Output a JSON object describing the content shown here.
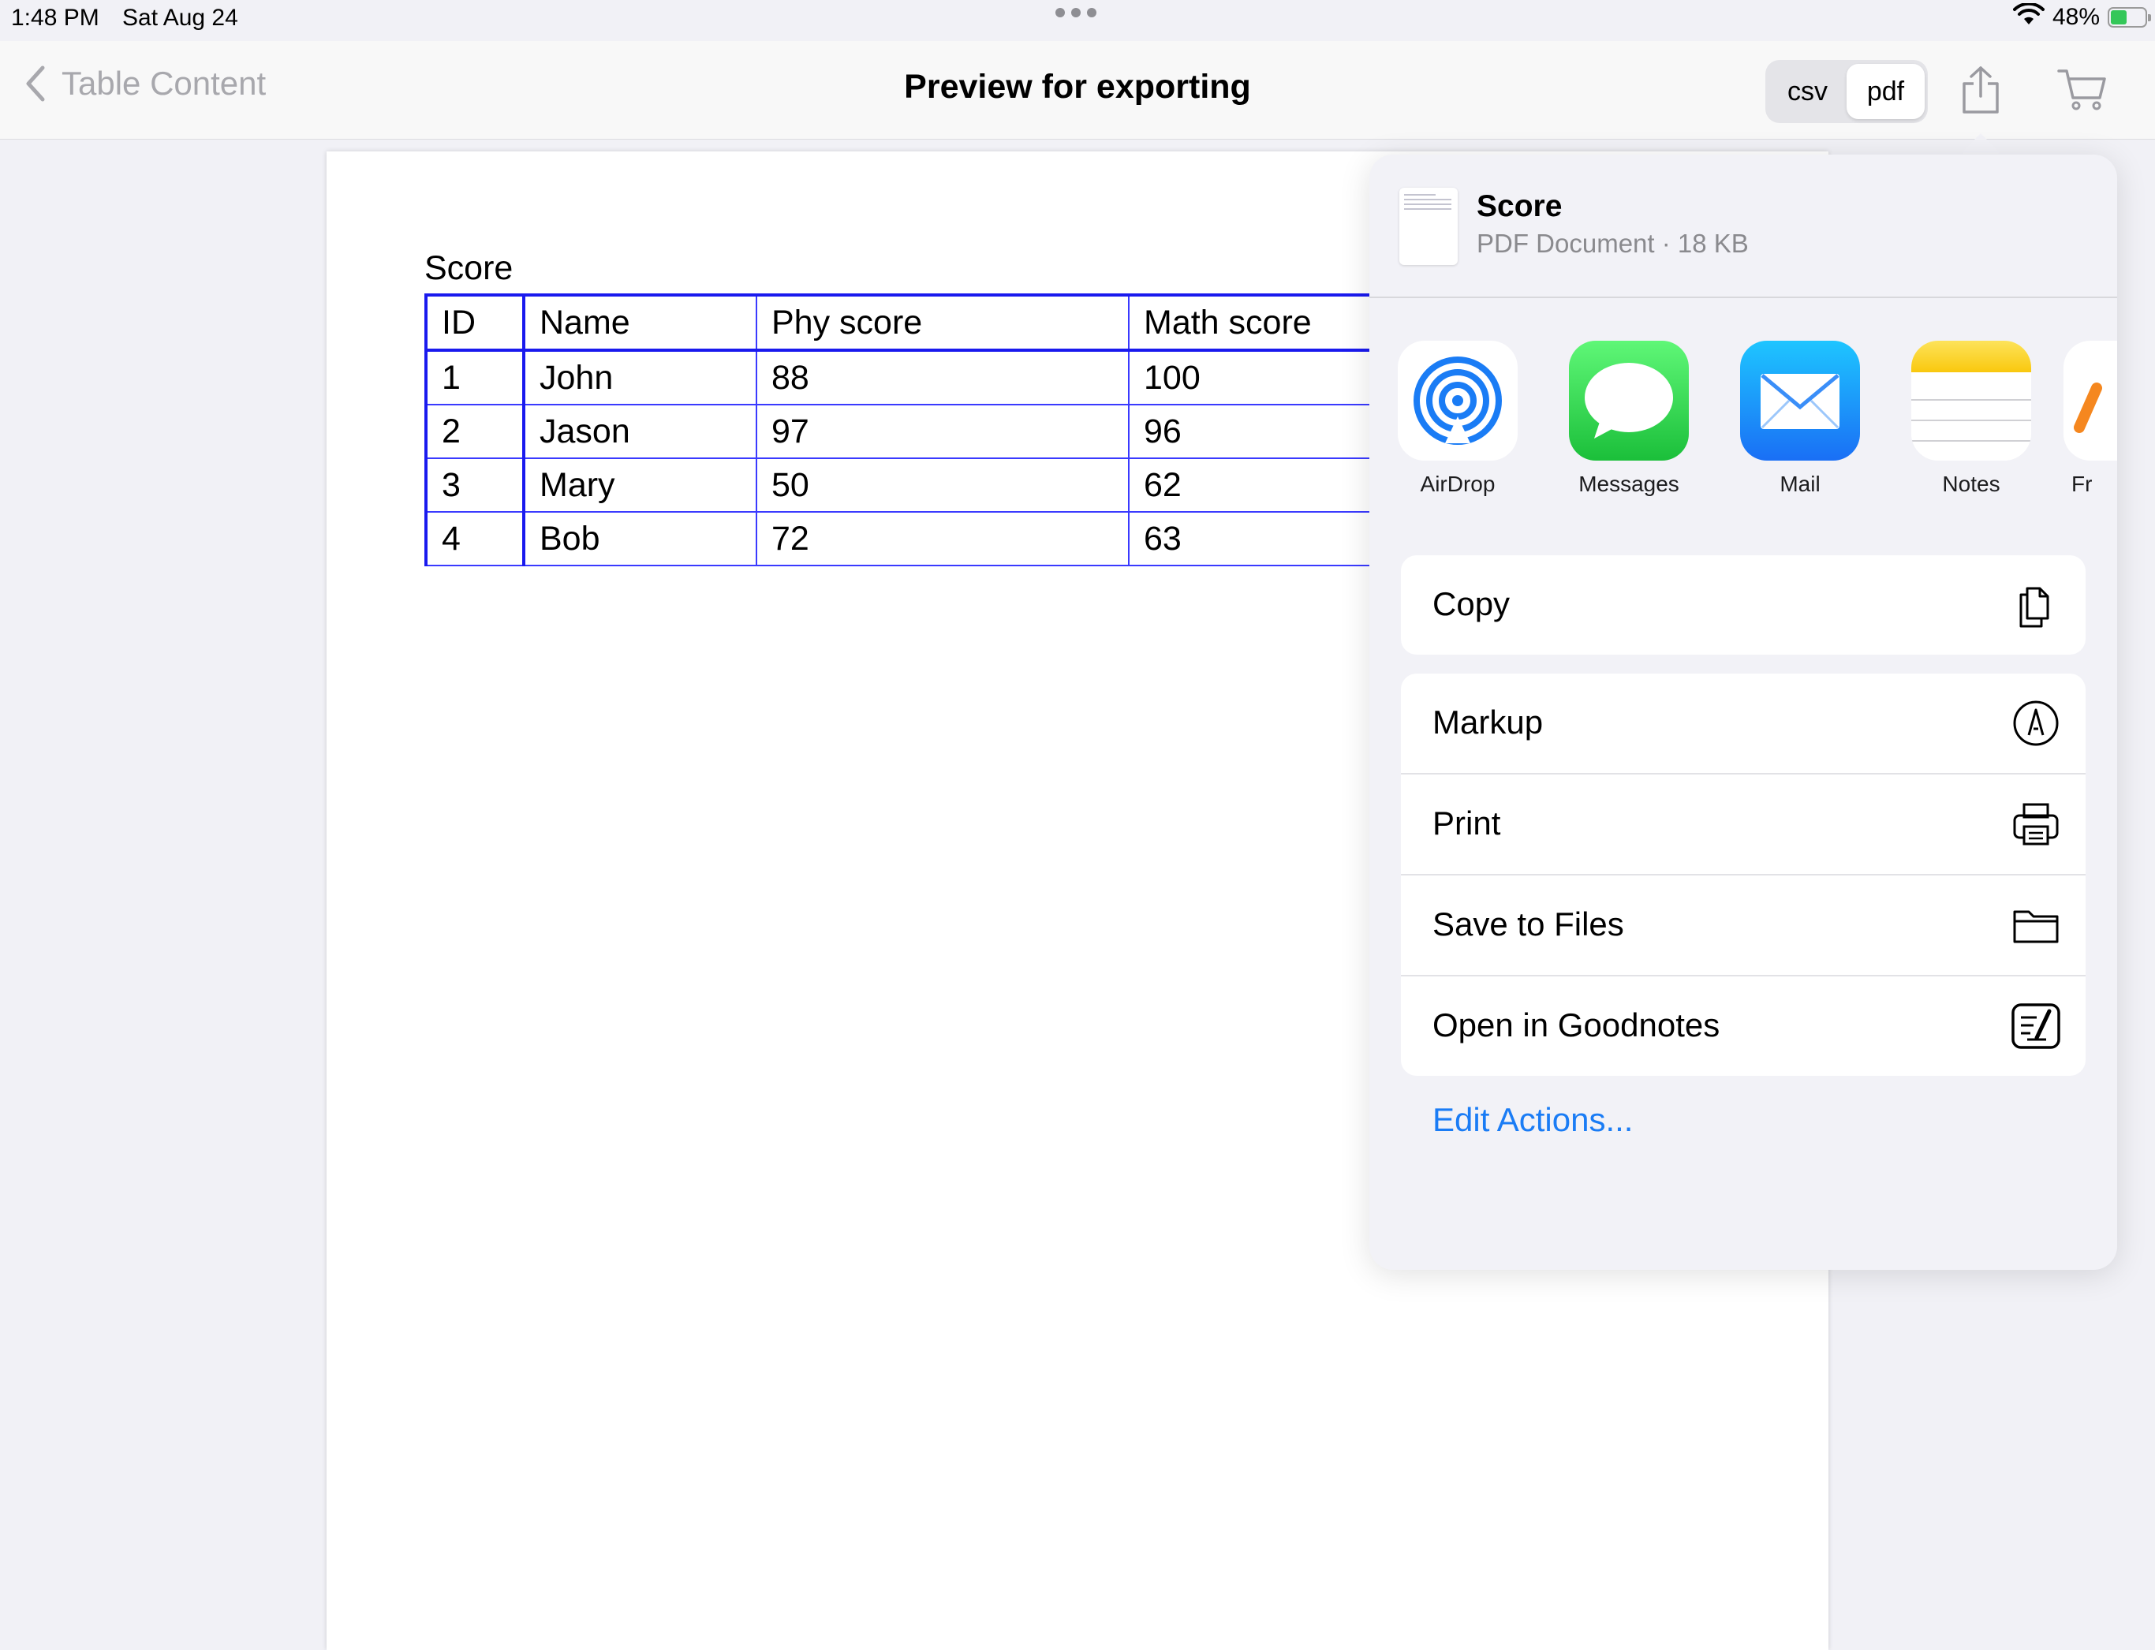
{
  "status_bar": {
    "time": "1:48 PM",
    "date": "Sat Aug 24",
    "battery_percent": "48%",
    "battery_level": 0.48,
    "icons": [
      "wifi-icon",
      "battery-charging-icon"
    ]
  },
  "nav": {
    "back_label": "Table Content",
    "title": "Preview for exporting",
    "format_options": [
      "csv",
      "pdf"
    ],
    "selected_format": "pdf"
  },
  "document": {
    "caption": "Score",
    "columns": [
      "ID",
      "Name",
      "Phy score",
      "Math score"
    ],
    "rows": [
      [
        "1",
        "John",
        "88",
        "100"
      ],
      [
        "2",
        "Jason",
        "97",
        "96"
      ],
      [
        "3",
        "Mary",
        "50",
        "62"
      ],
      [
        "4",
        "Bob",
        "72",
        "63"
      ]
    ]
  },
  "share_sheet": {
    "file_name": "Score",
    "file_meta": "PDF Document · 18 KB",
    "apps": [
      {
        "label": "AirDrop",
        "icon": "airdrop-icon"
      },
      {
        "label": "Messages",
        "icon": "messages-icon"
      },
      {
        "label": "Mail",
        "icon": "mail-icon"
      },
      {
        "label": "Notes",
        "icon": "notes-icon"
      },
      {
        "label": "Fr",
        "icon": "freeform-icon"
      }
    ],
    "copy_label": "Copy",
    "actions": [
      {
        "label": "Markup",
        "icon": "markup-icon"
      },
      {
        "label": "Print",
        "icon": "printer-icon"
      },
      {
        "label": "Save to Files",
        "icon": "folder-icon"
      },
      {
        "label": "Open in Goodnotes",
        "icon": "goodnotes-icon"
      }
    ],
    "edit_actions_label": "Edit Actions...",
    "link_color": "#1a7cf5"
  }
}
